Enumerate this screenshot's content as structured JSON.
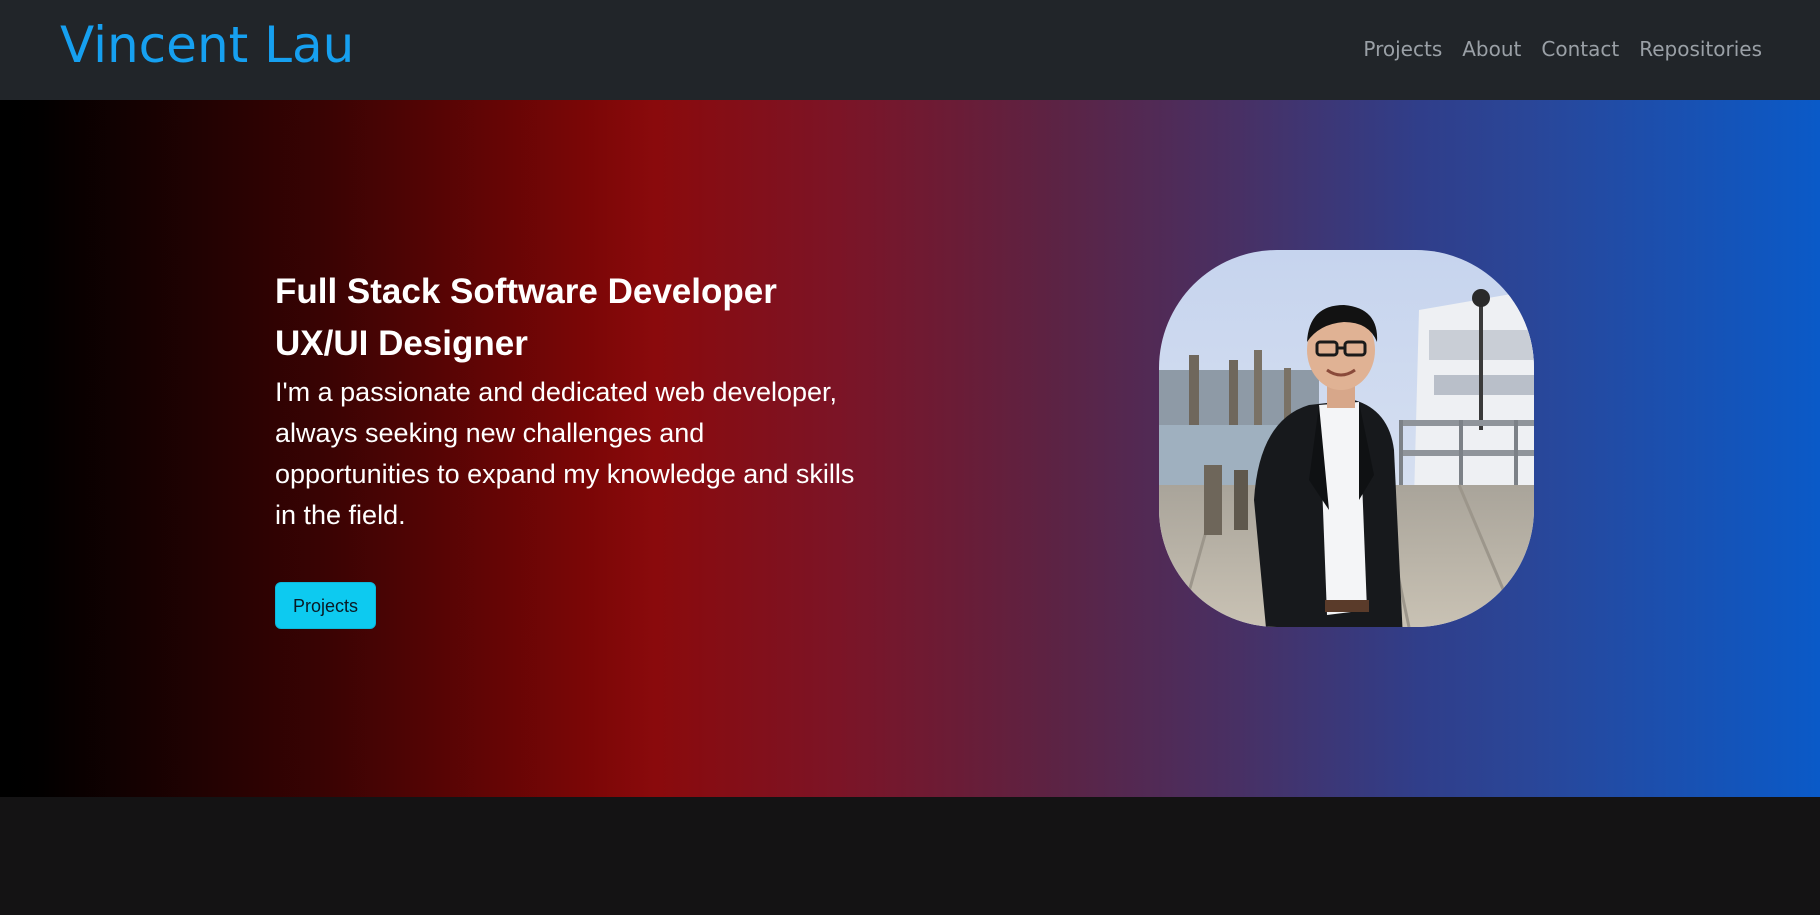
{
  "navbar": {
    "brand": "Vincent Lau",
    "links": [
      {
        "label": "Projects"
      },
      {
        "label": "About"
      },
      {
        "label": "Contact"
      },
      {
        "label": "Repositories"
      }
    ]
  },
  "hero": {
    "title_line1": "Full Stack Software Developer",
    "title_line2": "UX/UI Designer",
    "description": "I'm a passionate and dedicated web developer, always seeking new challenges and opportunities to expand my knowledge and skills in the field.",
    "button_label": "Projects"
  },
  "colors": {
    "brand": "#16a0f0",
    "navbar_bg": "#212529",
    "button_bg": "#0dcaf0",
    "gradient_start": "#000000",
    "gradient_mid": "#8a0a0c",
    "gradient_end": "#0a5ac8"
  },
  "icons": {
    "portrait": "profile-photo"
  }
}
